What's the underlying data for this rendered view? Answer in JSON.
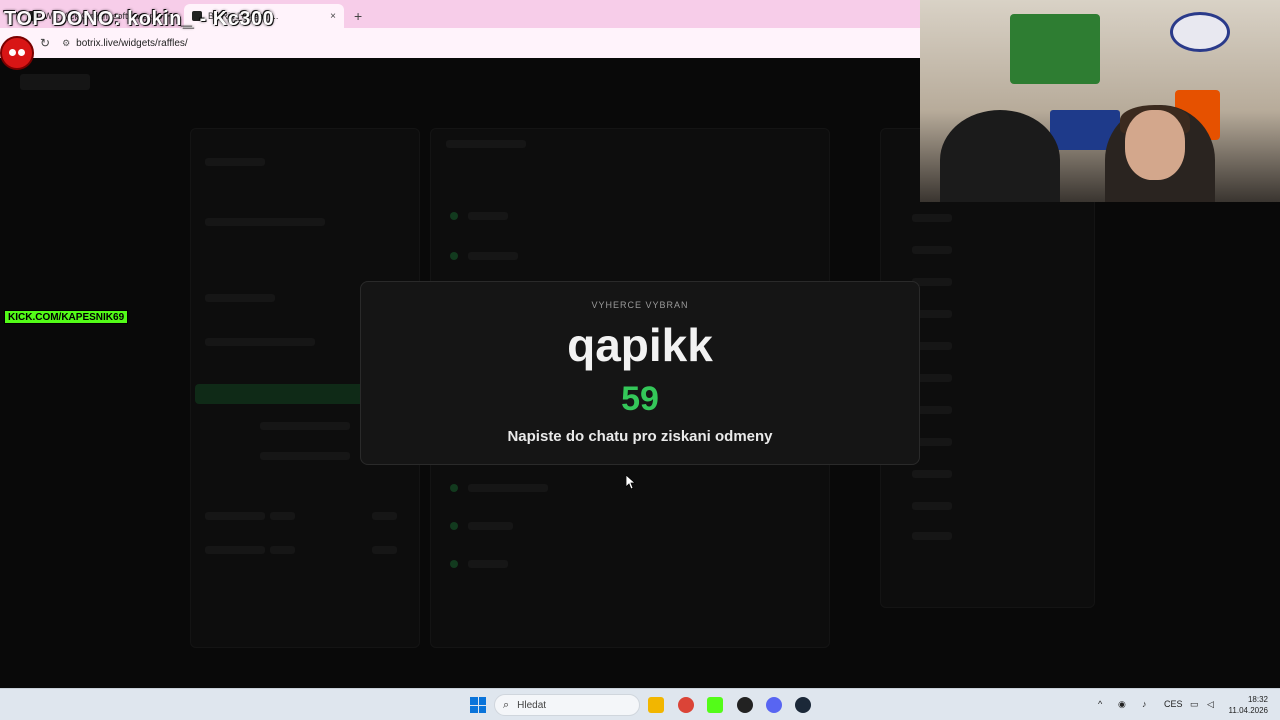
{
  "browser": {
    "tabs": [
      {
        "label": "W... Kick Stream software pro"
      },
      {
        "label": "BotRix | Stream..."
      }
    ],
    "new_tab_symbol": "+",
    "close_symbol": "×",
    "url": "botrix.live/widgets/raffles/"
  },
  "overlay": {
    "top_dono": "TOP DONO: kokin_ - Kc300",
    "kick_label": "KICK.COM/KAPESNIK69"
  },
  "winner": {
    "label": "VYHERCE VYBRAN",
    "name": "qapikk",
    "number": "59",
    "message": "Napiste do chatu pro ziskani odmeny"
  },
  "taskbar": {
    "search_placeholder": "Hledat",
    "language": "CES",
    "time": "18:32",
    "date": "11.04.2026"
  },
  "colors": {
    "accent_green": "#34c759",
    "kick_green": "#53fc18",
    "tab_pink": "#f7cde9"
  }
}
